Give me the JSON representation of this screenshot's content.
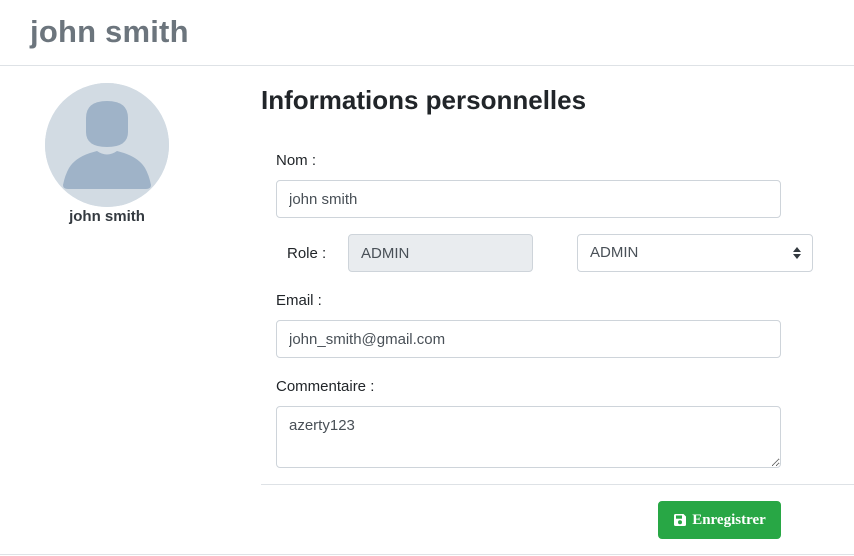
{
  "header": {
    "title": "john smith"
  },
  "profile": {
    "avatar_icon": "user-avatar-icon",
    "name": "john smith"
  },
  "form": {
    "title": "Informations personnelles",
    "nom": {
      "label": "Nom :",
      "value": "john smith"
    },
    "role": {
      "label": "Role :",
      "current_value": "ADMIN",
      "select_value": "ADMIN"
    },
    "email": {
      "label": "Email :",
      "value": "john_smith@gmail.com"
    },
    "commentaire": {
      "label": "Commentaire :",
      "value": "azerty123"
    },
    "save_button": {
      "label": "Enregistrer",
      "icon": "floppy-disk-icon"
    }
  },
  "colors": {
    "header_text": "#6c757d",
    "avatar_bg": "#d2dbe3",
    "avatar_figure": "#9fb3c8",
    "success": "#28a745"
  }
}
